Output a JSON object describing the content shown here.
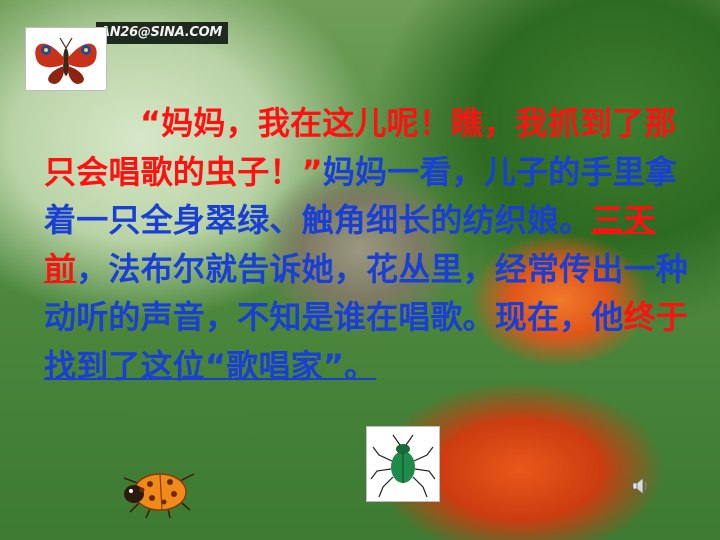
{
  "watermark": {
    "text": "AN26@SINA.COM"
  },
  "icons": {
    "butterfly": "butterfly-icon",
    "beetle": "beetle-icon",
    "ladybug": "ladybug-icon",
    "speaker": "speaker-icon"
  },
  "colors": {
    "red": "#ff1111",
    "blue": "#1a3fd4"
  },
  "paragraph": {
    "quote_open": "“妈妈，我在这儿呢！瞧，我抓到了那只会唱歌的虫子！”",
    "mom_see": "妈妈一看，儿子的手里拿着一只全身翠绿、触角细长的纺织娘。",
    "three_days_ago": "三天前",
    "middle": "，法布尔就告诉她，花丛里，经常传出一种动听的声音，不知是谁在唱歌。现在，他",
    "finally": "终于",
    "end": "找到了这位“歌唱家”。"
  }
}
